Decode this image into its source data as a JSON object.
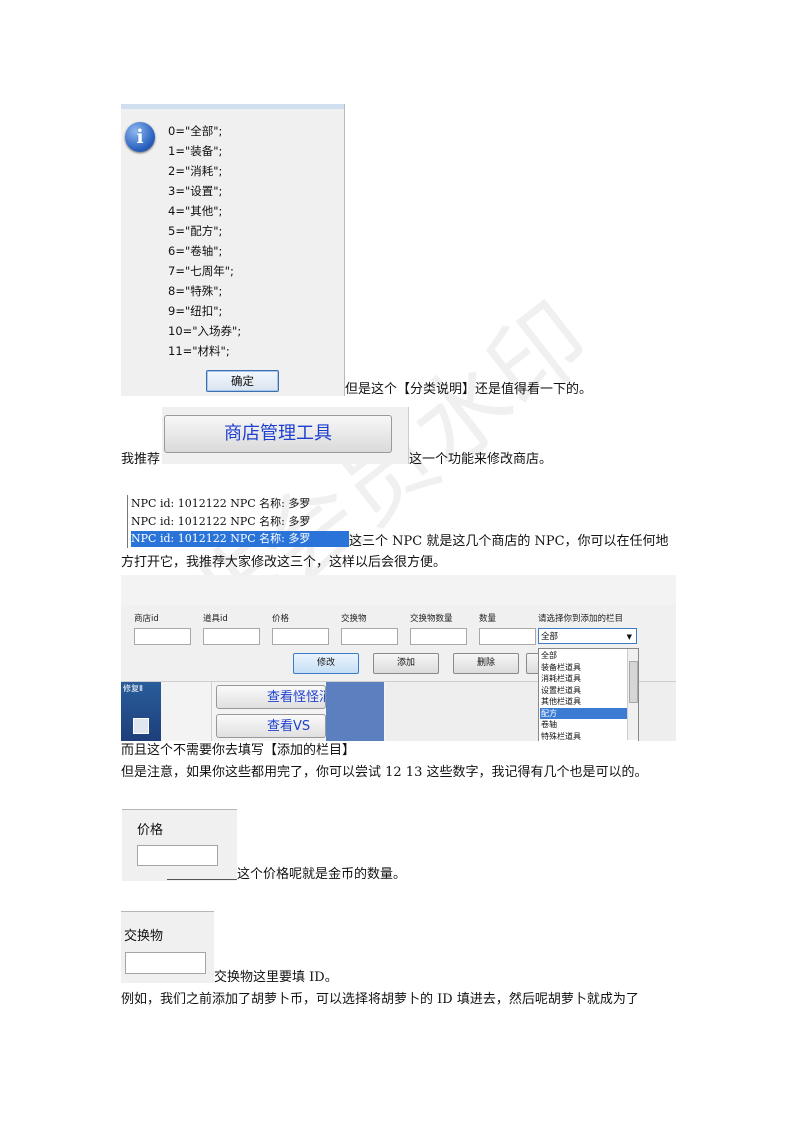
{
  "message_box": {
    "lines": [
      "0=\"全部\";",
      "1=\"装备\";",
      "2=\"消耗\";",
      "3=\"设置\";",
      "4=\"其他\";",
      "5=\"配方\";",
      "6=\"卷轴\";",
      "7=\"七周年\";",
      "8=\"特殊\";",
      "9=\"纽扣\";",
      "10=\"入场券\";",
      "11=\"材料\";"
    ],
    "ok_label": "确定"
  },
  "p1": "但是这个【分类说明】还是值得看一下的。",
  "shop_button_label": "商店管理工具",
  "p2_before": "我推荐",
  "p2_after": "这一个功能来修改商店。",
  "npc_rows": [
    "NPC id: 1012122  NPC 名称: 多罗",
    "NPC id: 1012122  NPC 名称: 多罗",
    "NPC id: 1012122  NPC 名称: 多罗"
  ],
  "p3_line1": "这三个 NPC 就是这几个商店的 NPC，你可以在任何地",
  "p3_line2": "方打开它，我推荐大家修改这三个，这样以后会很方便。",
  "tool": {
    "labels": [
      "商店id",
      "道具id",
      "价格",
      "交换物",
      "交换物数量",
      "数量",
      "请选择你到添加的栏目"
    ],
    "buttons": [
      "修改",
      "添加",
      "删除"
    ],
    "dropdown_selected": "全部",
    "dropdown_items": [
      "全部",
      "装备栏道具",
      "消耗栏道具",
      "设置栏道具",
      "其他栏道具",
      "配方",
      "卷轴",
      "特殊栏道具"
    ],
    "view_buttons": [
      "查看怪怪消",
      "查看VS"
    ],
    "desktop_label": "修复Ⅱ"
  },
  "p4": "而且这个不需要你去填写【添加的栏目】",
  "p5": "但是注意，如果你这些都用完了，你可以尝试 12 13 这些数字，我记得有几个也是可以的。",
  "price_label": "价格",
  "p6": "这个价格呢就是金币的数量。",
  "exchange_label": "交换物",
  "p7": "交换物这里要填 ID。",
  "p8": "例如，我们之前添加了胡萝卜币，可以选择将胡萝卜的 ID 填进去，然后呢胡萝卜就成为了",
  "watermark": "非会员水印"
}
